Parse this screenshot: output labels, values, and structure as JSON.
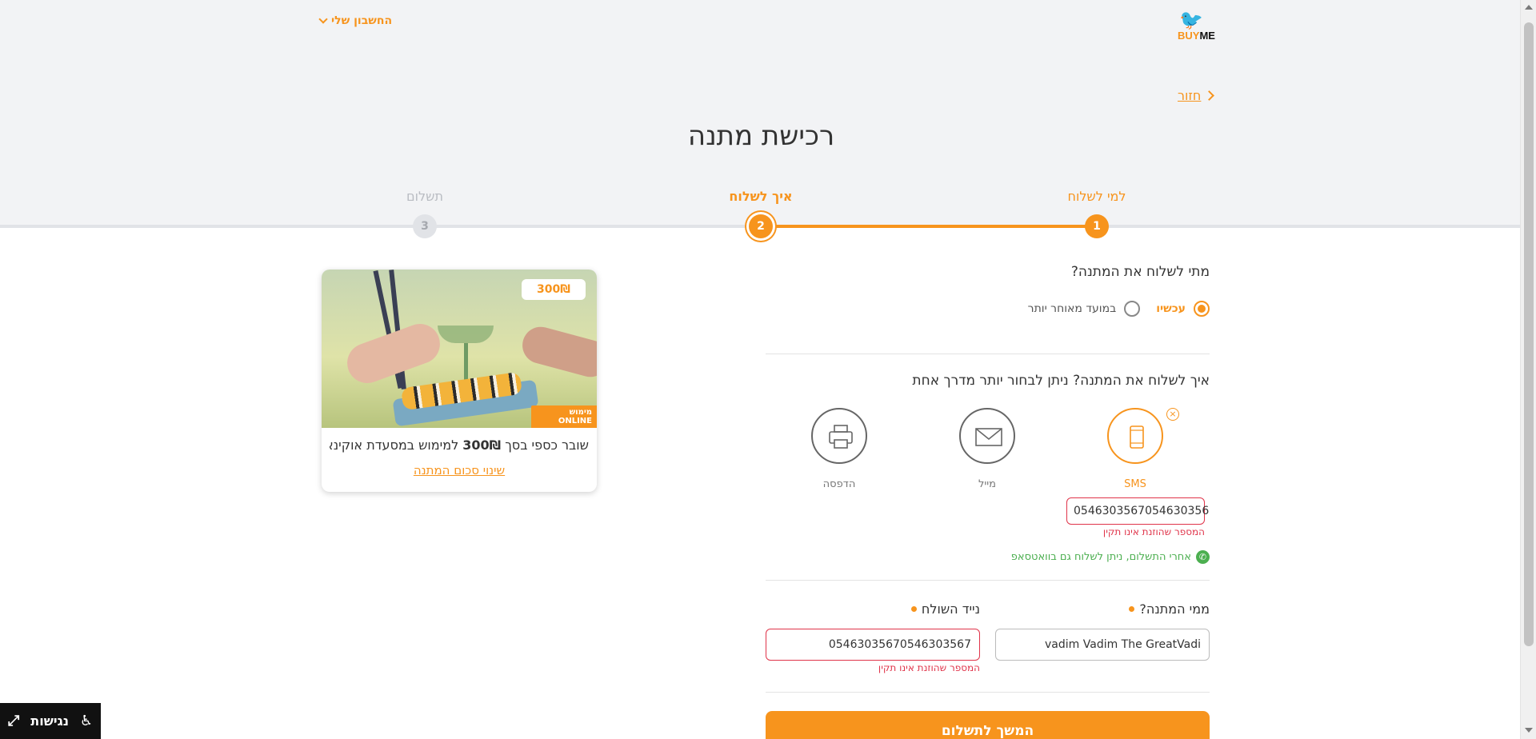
{
  "header": {
    "brand_buy": "BUY",
    "brand_me": "ME",
    "account_label": "החשבון שלי"
  },
  "nav": {
    "back_label": "חזור"
  },
  "page": {
    "title": "רכישת מתנה"
  },
  "steps": [
    {
      "number": "1",
      "label": "למי לשלוח",
      "state": "done"
    },
    {
      "number": "2",
      "label": "איך לשלוח",
      "state": "active"
    },
    {
      "number": "3",
      "label": "תשלום",
      "state": "pending"
    }
  ],
  "when": {
    "question": "מתי לשלוח את המתנה?",
    "options": [
      {
        "label": "עכשיו",
        "selected": true
      },
      {
        "label": "במועד מאוחר יותר",
        "selected": false
      }
    ]
  },
  "how": {
    "question": "איך לשלוח את המתנה? ניתן לבחור יותר מדרך אחת",
    "methods": [
      {
        "label": "SMS",
        "icon": "mobile-phone-icon",
        "selected": true
      },
      {
        "label": "מייל",
        "icon": "envelope-icon",
        "selected": false
      },
      {
        "label": "הדפסה",
        "icon": "printer-icon",
        "selected": false
      }
    ],
    "sms_phone_value": "0546303567054630356",
    "sms_phone_error": "המספר שהוזנת אינו תקין",
    "whatsapp_note": "אחרי התשלום, ניתן לשלוח גם בוואטסאפ"
  },
  "sender": {
    "from_label": "ממי המתנה?",
    "from_value": "vadim Vadim The GreatVadi",
    "phone_label": "נייד השולח",
    "phone_value": "05463035670546303567",
    "phone_error": "המספר שהוזנת אינו תקין"
  },
  "actions": {
    "continue_label": "המשך לתשלום"
  },
  "gift_card": {
    "price": "300₪",
    "online_badge": "מימוש ONLINE",
    "desc_prefix": "שובר כספי בסך ",
    "desc_amount": "300₪",
    "desc_suffix": " למימוש במסעדת אוקינאו...",
    "change_amount_label": "שינוי סכום המתנה"
  },
  "accessibility": {
    "label": "נגישות"
  },
  "colors": {
    "accent": "#f7941d",
    "error": "#e0344a",
    "whatsapp": "#4caf50"
  }
}
